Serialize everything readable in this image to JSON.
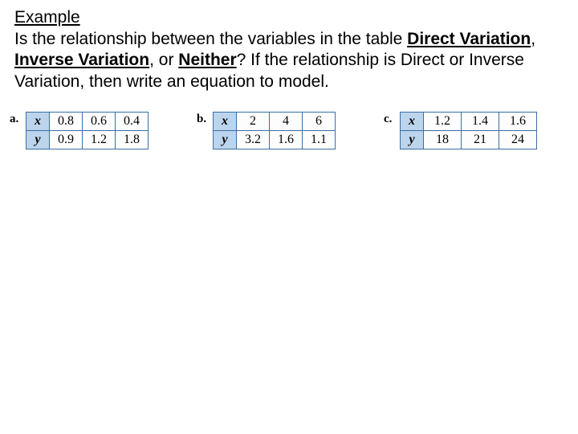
{
  "heading": "Example",
  "body": {
    "p1_a": "Is the relationship between the variables in the table ",
    "p1_b": "Direct Variation",
    "p1_c": ", ",
    "p1_d": "Inverse Variation",
    "p1_e": ", or ",
    "p1_f": "Neither",
    "p1_g": "?  If the relationship is Direct or Inverse Variation, then write an equation to model."
  },
  "tables": {
    "a": {
      "label": "a.",
      "x_label": "x",
      "y_label": "y",
      "x": [
        "0.8",
        "0.6",
        "0.4"
      ],
      "y": [
        "0.9",
        "1.2",
        "1.8"
      ]
    },
    "b": {
      "label": "b.",
      "x_label": "x",
      "y_label": "y",
      "x": [
        "2",
        "4",
        "6"
      ],
      "y": [
        "3.2",
        "1.6",
        "1.1"
      ]
    },
    "c": {
      "label": "c.",
      "x_label": "x",
      "y_label": "y",
      "x": [
        "1.2",
        "1.4",
        "1.6"
      ],
      "y": [
        "18",
        "21",
        "24"
      ]
    }
  }
}
